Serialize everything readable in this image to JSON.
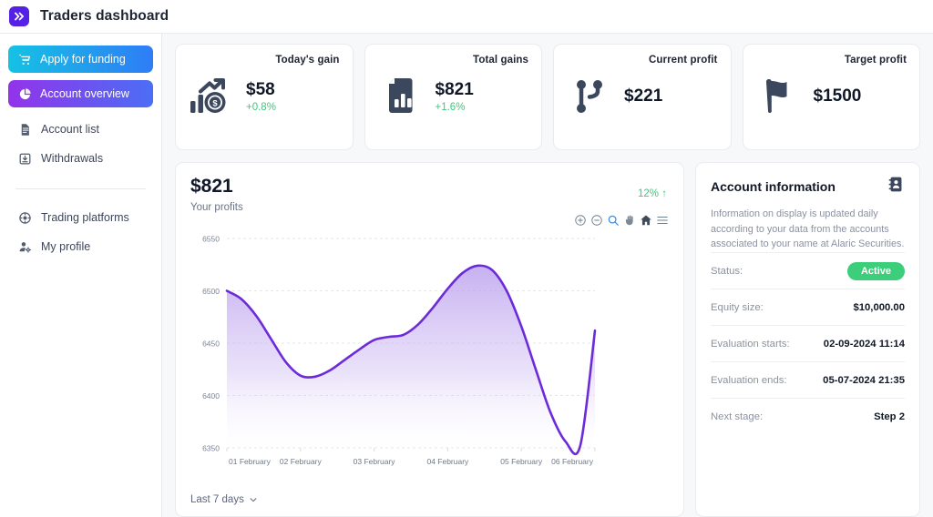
{
  "header": {
    "title": "Traders dashboard",
    "logo_icon": "double-chevron-icon",
    "logo_color": "#5521e6"
  },
  "sidebar": {
    "primary_actions": [
      {
        "label": "Apply for funding",
        "icon": "shopping-cart-icon",
        "gradient_from": "#15c2e4",
        "gradient_to": "#2e7df6"
      },
      {
        "label": "Account overview",
        "icon": "pie-chart-icon",
        "gradient_from": "#9333ea",
        "gradient_to": "#4b6ef5",
        "active": true
      }
    ],
    "items": [
      {
        "label": "Account list",
        "icon": "document-icon"
      },
      {
        "label": "Withdrawals",
        "icon": "download-box-icon"
      }
    ],
    "items_secondary": [
      {
        "label": "Trading platforms",
        "icon": "globe-wheel-icon"
      },
      {
        "label": "My profile",
        "icon": "person-gear-icon"
      }
    ]
  },
  "stats": [
    {
      "label": "Today's gain",
      "value": "$58",
      "delta": "+0.8%",
      "icon": "chart-up-money-icon"
    },
    {
      "label": "Total gains",
      "value": "$821",
      "delta": "+1.6%",
      "icon": "report-bars-icon"
    },
    {
      "label": "Current profit",
      "value": "$221",
      "delta": "",
      "icon": "git-branch-icon"
    },
    {
      "label": "Target profit",
      "value": "$1500",
      "delta": "",
      "icon": "flag-icon"
    }
  ],
  "chart_panel": {
    "amount": "$821",
    "subtitle": "Your profits",
    "percent": "12%",
    "percent_arrow": "↑",
    "percent_color": "#3dc97a",
    "range_label": "Last 7 days",
    "toolbar": [
      {
        "name": "zoom-in-icon"
      },
      {
        "name": "zoom-out-icon"
      },
      {
        "name": "selection-zoom-icon",
        "active": true
      },
      {
        "name": "pan-hand-icon"
      },
      {
        "name": "reset-home-icon"
      },
      {
        "name": "menu-icon"
      }
    ]
  },
  "chart_data": {
    "type": "area",
    "title": "Your profits",
    "xlabel": "",
    "ylabel": "",
    "grid": true,
    "legend": "none",
    "line_color": "#6c2bd9",
    "fill_from": "#c4aef0",
    "fill_to": "#ffffff",
    "ylim": [
      6350,
      6550
    ],
    "yticks": [
      6550,
      6500,
      6450,
      6400,
      6350
    ],
    "categories": [
      "01 February",
      "02 February",
      "03 February",
      "04 February",
      "05 February",
      "06 February"
    ],
    "x": [
      0,
      0.2,
      0.4,
      0.6,
      0.8,
      1.0,
      1.2,
      1.4,
      1.6,
      1.8,
      2.0,
      2.2,
      2.4,
      2.6,
      2.8,
      3.0,
      3.2,
      3.4,
      3.6,
      3.8,
      4.0,
      4.2,
      4.4,
      4.6,
      4.8,
      5.0
    ],
    "values": [
      6500,
      6492,
      6476,
      6454,
      6432,
      6419,
      6418,
      6424,
      6434,
      6444,
      6453,
      6456,
      6458,
      6468,
      6484,
      6502,
      6517,
      6524,
      6520,
      6500,
      6466,
      6424,
      6383,
      6356,
      6352,
      6462
    ],
    "series": [
      {
        "name": "Your profits",
        "values": [
          6500,
          6492,
          6476,
          6454,
          6432,
          6419,
          6418,
          6424,
          6434,
          6444,
          6453,
          6456,
          6458,
          6468,
          6484,
          6502,
          6517,
          6524,
          6520,
          6500,
          6466,
          6424,
          6383,
          6356,
          6352,
          6462
        ]
      }
    ]
  },
  "info": {
    "title": "Account information",
    "icon": "contact-card-icon",
    "description": "Information on display is updated daily according to your data from the accounts associated to your name at Alaric Securities.",
    "rows": [
      {
        "key": "Status:",
        "value": "Active",
        "type": "badge",
        "color": "#3cce7b"
      },
      {
        "key": "Equity size:",
        "value": "$10,000.00",
        "type": "text"
      },
      {
        "key": "Evaluation starts:",
        "value": "02-09-2024 11:14",
        "type": "text"
      },
      {
        "key": "Evaluation ends:",
        "value": "05-07-2024 21:35",
        "type": "text"
      },
      {
        "key": "Next stage:",
        "value": "Step 2",
        "type": "text"
      }
    ]
  }
}
